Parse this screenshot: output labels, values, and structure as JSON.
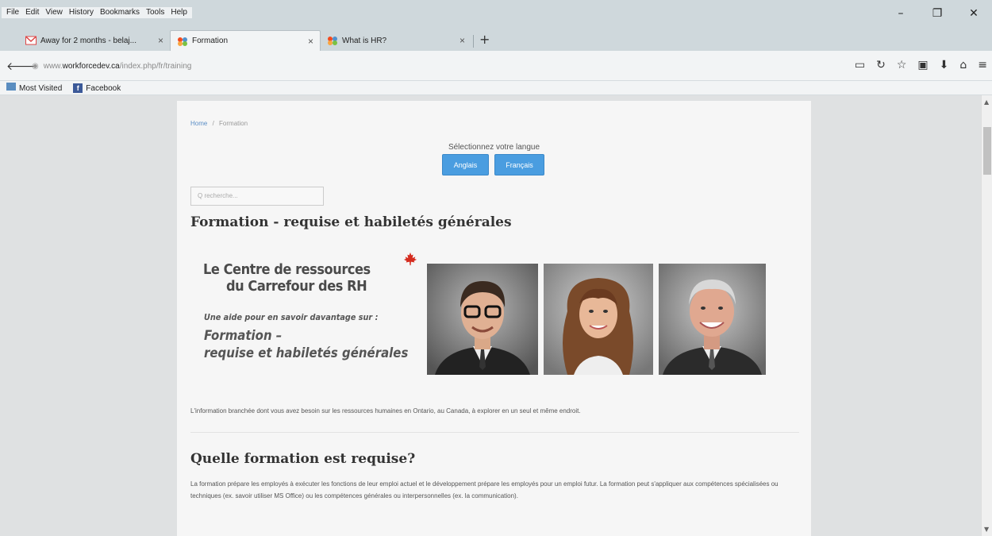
{
  "browser": {
    "menu": [
      "File",
      "Edit",
      "View",
      "History",
      "Bookmarks",
      "Tools",
      "Help"
    ],
    "tabs": [
      {
        "title": "Away for 2 months - belaj...",
        "close": "×"
      },
      {
        "title": "Formation",
        "close": "×"
      },
      {
        "title": "What is HR?",
        "close": "×"
      }
    ],
    "new_tab": "+",
    "url_prefix": "www.",
    "url_host": "workforcedev.ca",
    "url_path": "/index.php/fr/training",
    "bookmarks": [
      "Most Visited",
      "Facebook"
    ],
    "window_controls": {
      "minimize": "–",
      "restore": "❐",
      "close": "✕"
    }
  },
  "page": {
    "breadcrumb": {
      "home": "Home",
      "sep": "/",
      "current": "Formation"
    },
    "language": {
      "label": "Sélectionnez votre langue",
      "english": "Anglais",
      "french": "Français"
    },
    "search_placeholder": "Q recherche...",
    "title": "Formation - requise et habiletés générales",
    "banner": {
      "line1": "Le Centre de ressources",
      "line2": "du Carrefour des RH",
      "line3": "Une aide pour en savoir davantage sur :",
      "line4": "Formation –",
      "line5": "requise et habiletés générales"
    },
    "intro": "L'information branchée dont vous avez besoin sur les ressources humaines en Ontario, au Canada, à explorer en un seul et même endroit.",
    "section_title": "Quelle formation est requise?",
    "section_text": "La formation prépare les employés à exécuter les fonctions de leur emploi actuel et le développement prépare les employés pour un emploi futur. La formation peut s'appliquer aux compétences spécialisées ou techniques (ex. savoir utiliser MS Office) ou les compétences générales ou interpersonnelles (ex. la communication)."
  },
  "colors": {
    "accent": "#4a9de0",
    "maple": "#d52b1e"
  }
}
